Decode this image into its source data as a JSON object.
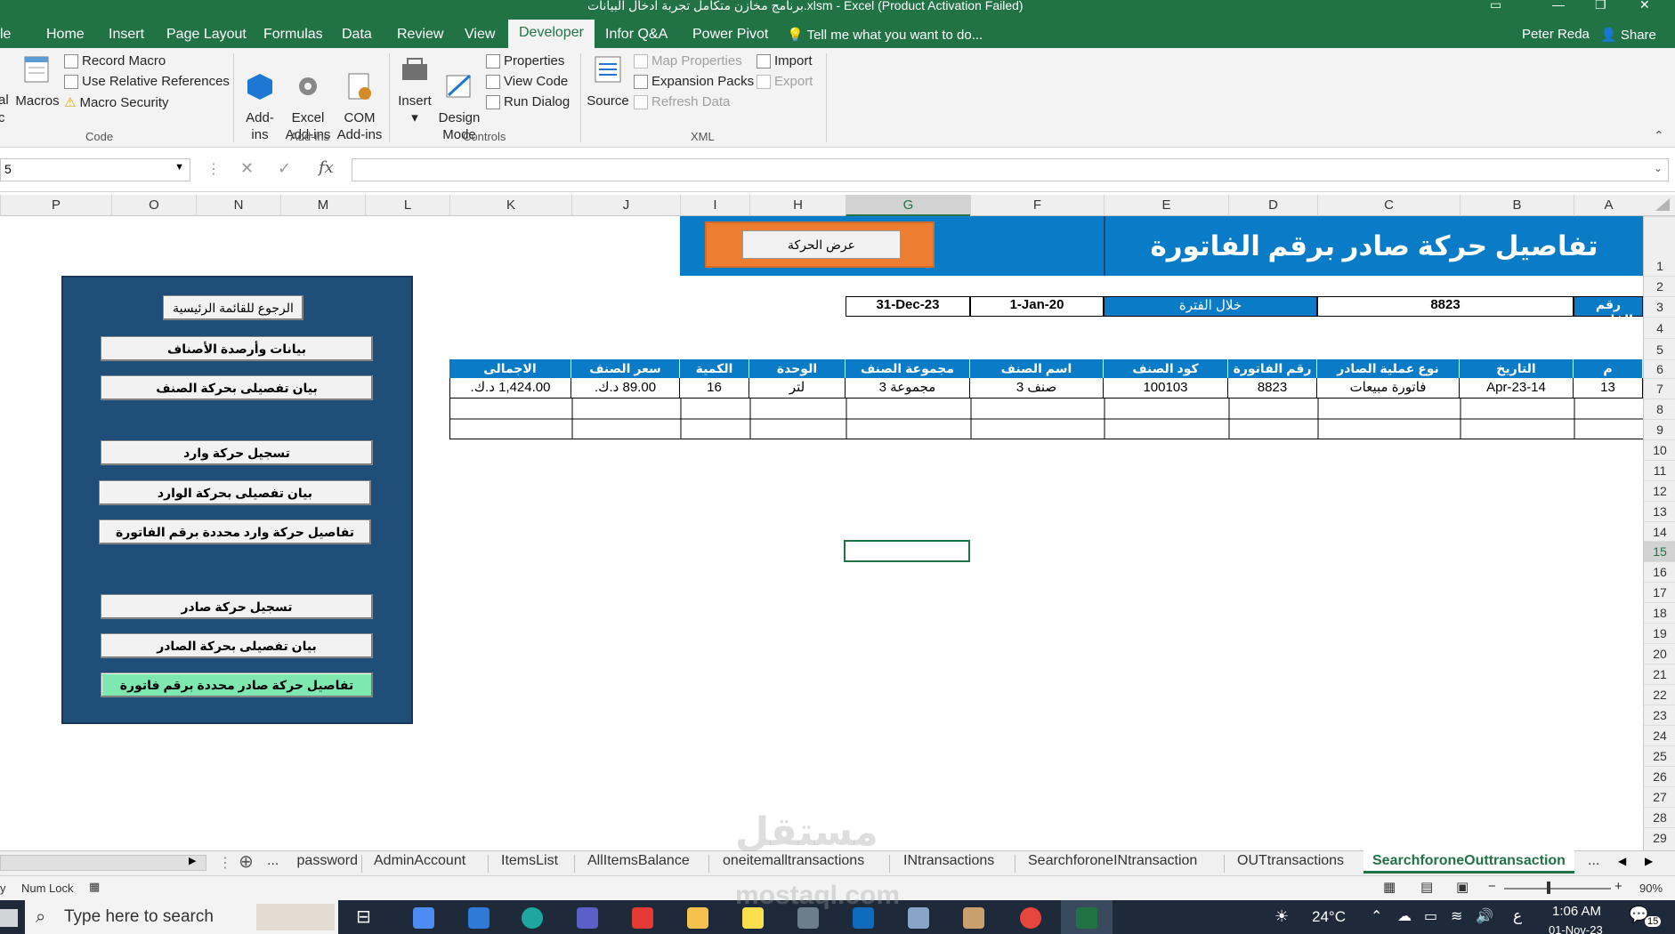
{
  "window": {
    "title": "برنامج مخازن متكامل تجربة ادخال البيانات.xlsm - Excel (Product Activation Failed)"
  },
  "tabs": [
    {
      "label": "le"
    },
    {
      "label": "Home"
    },
    {
      "label": "Insert"
    },
    {
      "label": "Page Layout"
    },
    {
      "label": "Formulas"
    },
    {
      "label": "Data"
    },
    {
      "label": "Review"
    },
    {
      "label": "View"
    },
    {
      "label": "Developer"
    },
    {
      "label": "Infor Q&A"
    },
    {
      "label": "Power Pivot"
    }
  ],
  "tell_me": "Tell me what you want to do...",
  "user": "Peter Reda",
  "share": "Share",
  "ribbon": {
    "code": {
      "label": "Code",
      "visual": "al",
      "visual2": "c",
      "macros": "Macros",
      "record_macro": "Record Macro",
      "relative_refs": "Use Relative References",
      "macro_security": "Macro Security"
    },
    "addins": {
      "label": "Add-ins",
      "addins": "Add-\nins",
      "excel_addins": "Excel\nAdd-ins",
      "com_addins": "COM\nAdd-ins"
    },
    "controls": {
      "label": "Controls",
      "insert": "Insert",
      "design_mode": "Design\nMode",
      "properties": "Properties",
      "view_code": "View Code",
      "run_dialog": "Run Dialog"
    },
    "xml": {
      "label": "XML",
      "source": "Source",
      "map_properties": "Map Properties",
      "expansion_packs": "Expansion Packs",
      "refresh_data": "Refresh Data",
      "import": "Import",
      "export": "Export"
    }
  },
  "formula_bar": {
    "name_box": "5",
    "fx": "fx"
  },
  "columns": [
    "P",
    "O",
    "N",
    "M",
    "L",
    "K",
    "J",
    "I",
    "H",
    "G",
    "F",
    "E",
    "D",
    "C",
    "B",
    "A"
  ],
  "rows": [
    "1",
    "2",
    "3",
    "4",
    "5",
    "6",
    "7",
    "8",
    "9",
    "10",
    "11",
    "12",
    "13",
    "14",
    "15",
    "16",
    "17",
    "18",
    "19",
    "20",
    "21",
    "22",
    "23",
    "24",
    "25",
    "26",
    "27",
    "28",
    "29"
  ],
  "sheet": {
    "title": "تفاصيل حركة صادر برقم الفاتورة",
    "show_button": "عرض الحركة",
    "invoice_label": "رقم الفاتورة",
    "invoice_value": "8823",
    "period_label": "خلال الفترة",
    "from_date": "1-Jan-20",
    "to_date": "31-Dec-23",
    "table_headers": [
      "م",
      "التاريخ",
      "نوع عملية الصادر",
      "رقم الفاتورة",
      "كود الصنف",
      "اسم الصنف",
      "مجموعة الصنف",
      "الوحدة",
      "الكمية",
      "سعر الصنف",
      "الاجمالى"
    ],
    "table_row": [
      "13",
      "14-Apr-23",
      "فاتورة مبيعات",
      "8823",
      "100103",
      "صنف 3",
      "مجموعة 3",
      "لتر",
      "16",
      "89.00 د.ك.",
      "1,424.00 د.ك."
    ]
  },
  "nav": {
    "back": "الرجوع للقائمة الرئيسية",
    "items_balance": "بيانات وأرصدة الأصناف",
    "item_detail": "بيان تفصيلى بحركة الصنف",
    "record_in": "تسجيل حركة وارد",
    "in_detail": "بيان تفصيلى بحركة الوارد",
    "in_by_invoice": "تفاصيل حركة وارد محددة برقم الفاتورة",
    "record_out": "تسجيل حركة صادر",
    "out_detail": "بيان تفصيلى بحركة الصادر",
    "out_by_invoice": "تفاصيل حركة صادر محددة برقم فاتورة"
  },
  "sheet_tabs": [
    "...",
    "password",
    "AdminAccount",
    "ItemsList",
    "AllItemsBalance",
    "oneitemalltransactions",
    "INtransactions",
    "SearchforoneINtransaction",
    "OUTtransactions",
    "SearchforoneOuttransaction",
    "..."
  ],
  "status": {
    "num_lock": "Num Lock",
    "zoom": "90%"
  },
  "taskbar": {
    "search": "Type here to search",
    "temperature": "24°C",
    "lang": "ع",
    "time": "1:06 AM",
    "date": "01-Nov-23",
    "notifications": "15"
  },
  "watermark": "مستقل",
  "watermark_url": "mostaql.com",
  "colors": {
    "excel_green": "#217346",
    "header_blue": "#0a7cc7",
    "panel_navy": "#1f4e79",
    "accent_orange": "#ed7d31",
    "active_green": "#7ee8b0"
  }
}
